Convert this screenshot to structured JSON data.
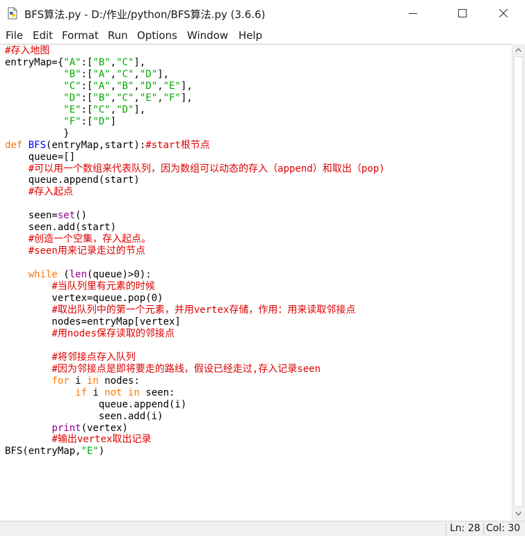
{
  "window": {
    "title": "BFS算法.py - D:/作业/python/BFS算法.py (3.6.6)",
    "controls": [
      "minimize",
      "maximize",
      "close"
    ]
  },
  "menu": {
    "file": "File",
    "edit": "Edit",
    "format": "Format",
    "run": "Run",
    "options": "Options",
    "window": "Window",
    "help": "Help"
  },
  "editor": {
    "lines": [
      "#存入地图",
      "entryMap={\"A\":[\"B\",\"C\"],",
      "          \"B\":[\"A\",\"C\",\"D\"],",
      "          \"C\":[\"A\",\"B\",\"D\",\"E\"],",
      "          \"D\":[\"B\",\"C\",\"E\",\"F\"],",
      "          \"E\":[\"C\",\"D\"],",
      "          \"F\":[\"D\"]",
      "          }",
      "def BFS(entryMap,start):#start根节点",
      "    queue=[]",
      "    #可以用一个数组来代表队列，因为数组可以动态的存入（append）和取出（pop)",
      "    queue.append(start)",
      "    #存入起点",
      "",
      "    seen=set()",
      "    seen.add(start)",
      "    #创造一个空集，存入起点。",
      "    #seen用来记录走过的节点",
      "",
      "    while (len(queue)>0):",
      "        #当队列里有元素的时候",
      "        vertex=queue.pop(0)",
      "        #取出队列中的第一个元素，并用vertex存储，作用：用来读取邻接点",
      "        nodes=entryMap[vertex]",
      "        #用nodes保存读取的邻接点",
      "",
      "        #将邻接点存入队列",
      "        #因为邻接点是即将要走的路线，假设已经走过,存入记录seen",
      "        for i in nodes:",
      "            if i not in seen:",
      "                queue.append(i)",
      "                seen.add(i)",
      "        print(vertex)",
      "        #输出vertex取出记录",
      "BFS(entryMap,\"E\")"
    ]
  },
  "status": {
    "line": "Ln: 28",
    "col": "Col: 30"
  },
  "colors": {
    "comment": "#dd0000",
    "keyword": "#ff7700",
    "string": "#00aa00",
    "builtin": "#900090",
    "definition": "#0000ff"
  }
}
